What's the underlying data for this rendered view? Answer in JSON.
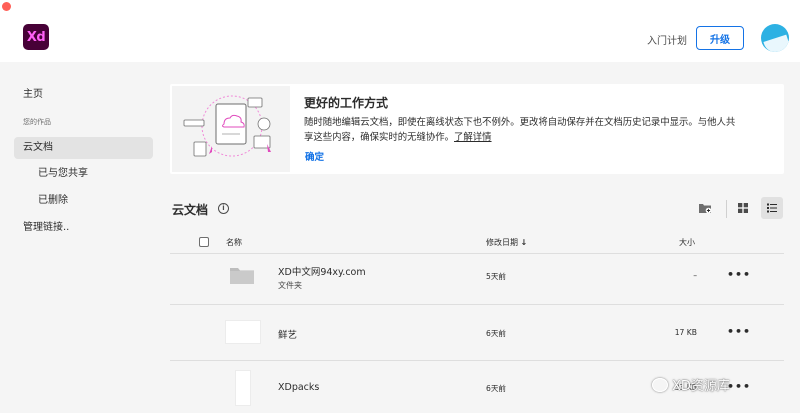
{
  "header": {
    "app_logo": "Xd",
    "plan_link": "入门计划",
    "upgrade_button": "升级",
    "accent_color": "#1473e6"
  },
  "sidebar": {
    "home": "主页",
    "caption": "您的作品",
    "cloud_docs": "云文档",
    "shared": "已与您共享",
    "deleted": "已删除",
    "manage_links": "管理链接.."
  },
  "banner": {
    "title": "更好的工作方式",
    "description": "随时随地编辑云文档，即使在离线状态下也不例外。更改将自动保存并在文档历史记录中显示。与他人共享这些内容，确保实时的无缝协作。",
    "learn_more": "了解详情",
    "confirm": "确定"
  },
  "section": {
    "title": "云文档",
    "info_icon": "info-icon"
  },
  "table": {
    "col_name": "名称",
    "col_modified": "修改日期",
    "col_size": "大小",
    "sort_icon": "arrow-down-icon",
    "rows": [
      {
        "name": "XD中文网94xy.com",
        "sub": "文件夹",
        "modified": "5天前",
        "size": "–",
        "type": "folder"
      },
      {
        "name": "鲜艺",
        "sub": "",
        "modified": "6天前",
        "size": "17 KB",
        "type": "document"
      },
      {
        "name": "XDpacks",
        "sub": "",
        "modified": "6天前",
        "size": "33 KB",
        "type": "document"
      }
    ]
  },
  "watermark": {
    "text": "XD资源库"
  }
}
